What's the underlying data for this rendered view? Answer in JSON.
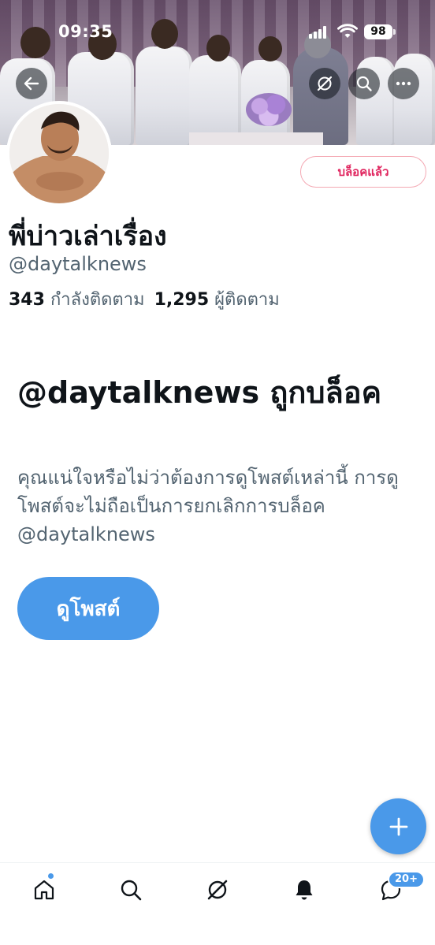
{
  "status_bar": {
    "time": "09:35",
    "battery": "98"
  },
  "profile": {
    "blocked_button_label": "บล็อคแล้ว",
    "display_name": "พี่บ่าวเล่าเรื่อง",
    "handle": "@daytalknews",
    "following_count": "343",
    "following_label": "กำลังติดตาม",
    "followers_count": "1,295",
    "followers_label": "ผู้ติดตาม"
  },
  "blocked_notice": {
    "title": "@daytalknews ถูกบล็อค",
    "description": "คุณแน่ใจหรือไม่ว่าต้องการดูโพสต์เหล่านี้ การดูโพสต์จะไม่ถือเป็นการยกเลิกการบล็อค @daytalknews",
    "view_posts_label": "ดูโพสต์"
  },
  "bottom_nav": {
    "items": [
      "home-icon",
      "search-icon",
      "grok-icon",
      "notifications-icon",
      "messages-icon"
    ],
    "messages_badge": "20+"
  },
  "colors": {
    "accent": "#4a99e9",
    "blocked_text": "#e0245e",
    "secondary_text": "#536471"
  }
}
